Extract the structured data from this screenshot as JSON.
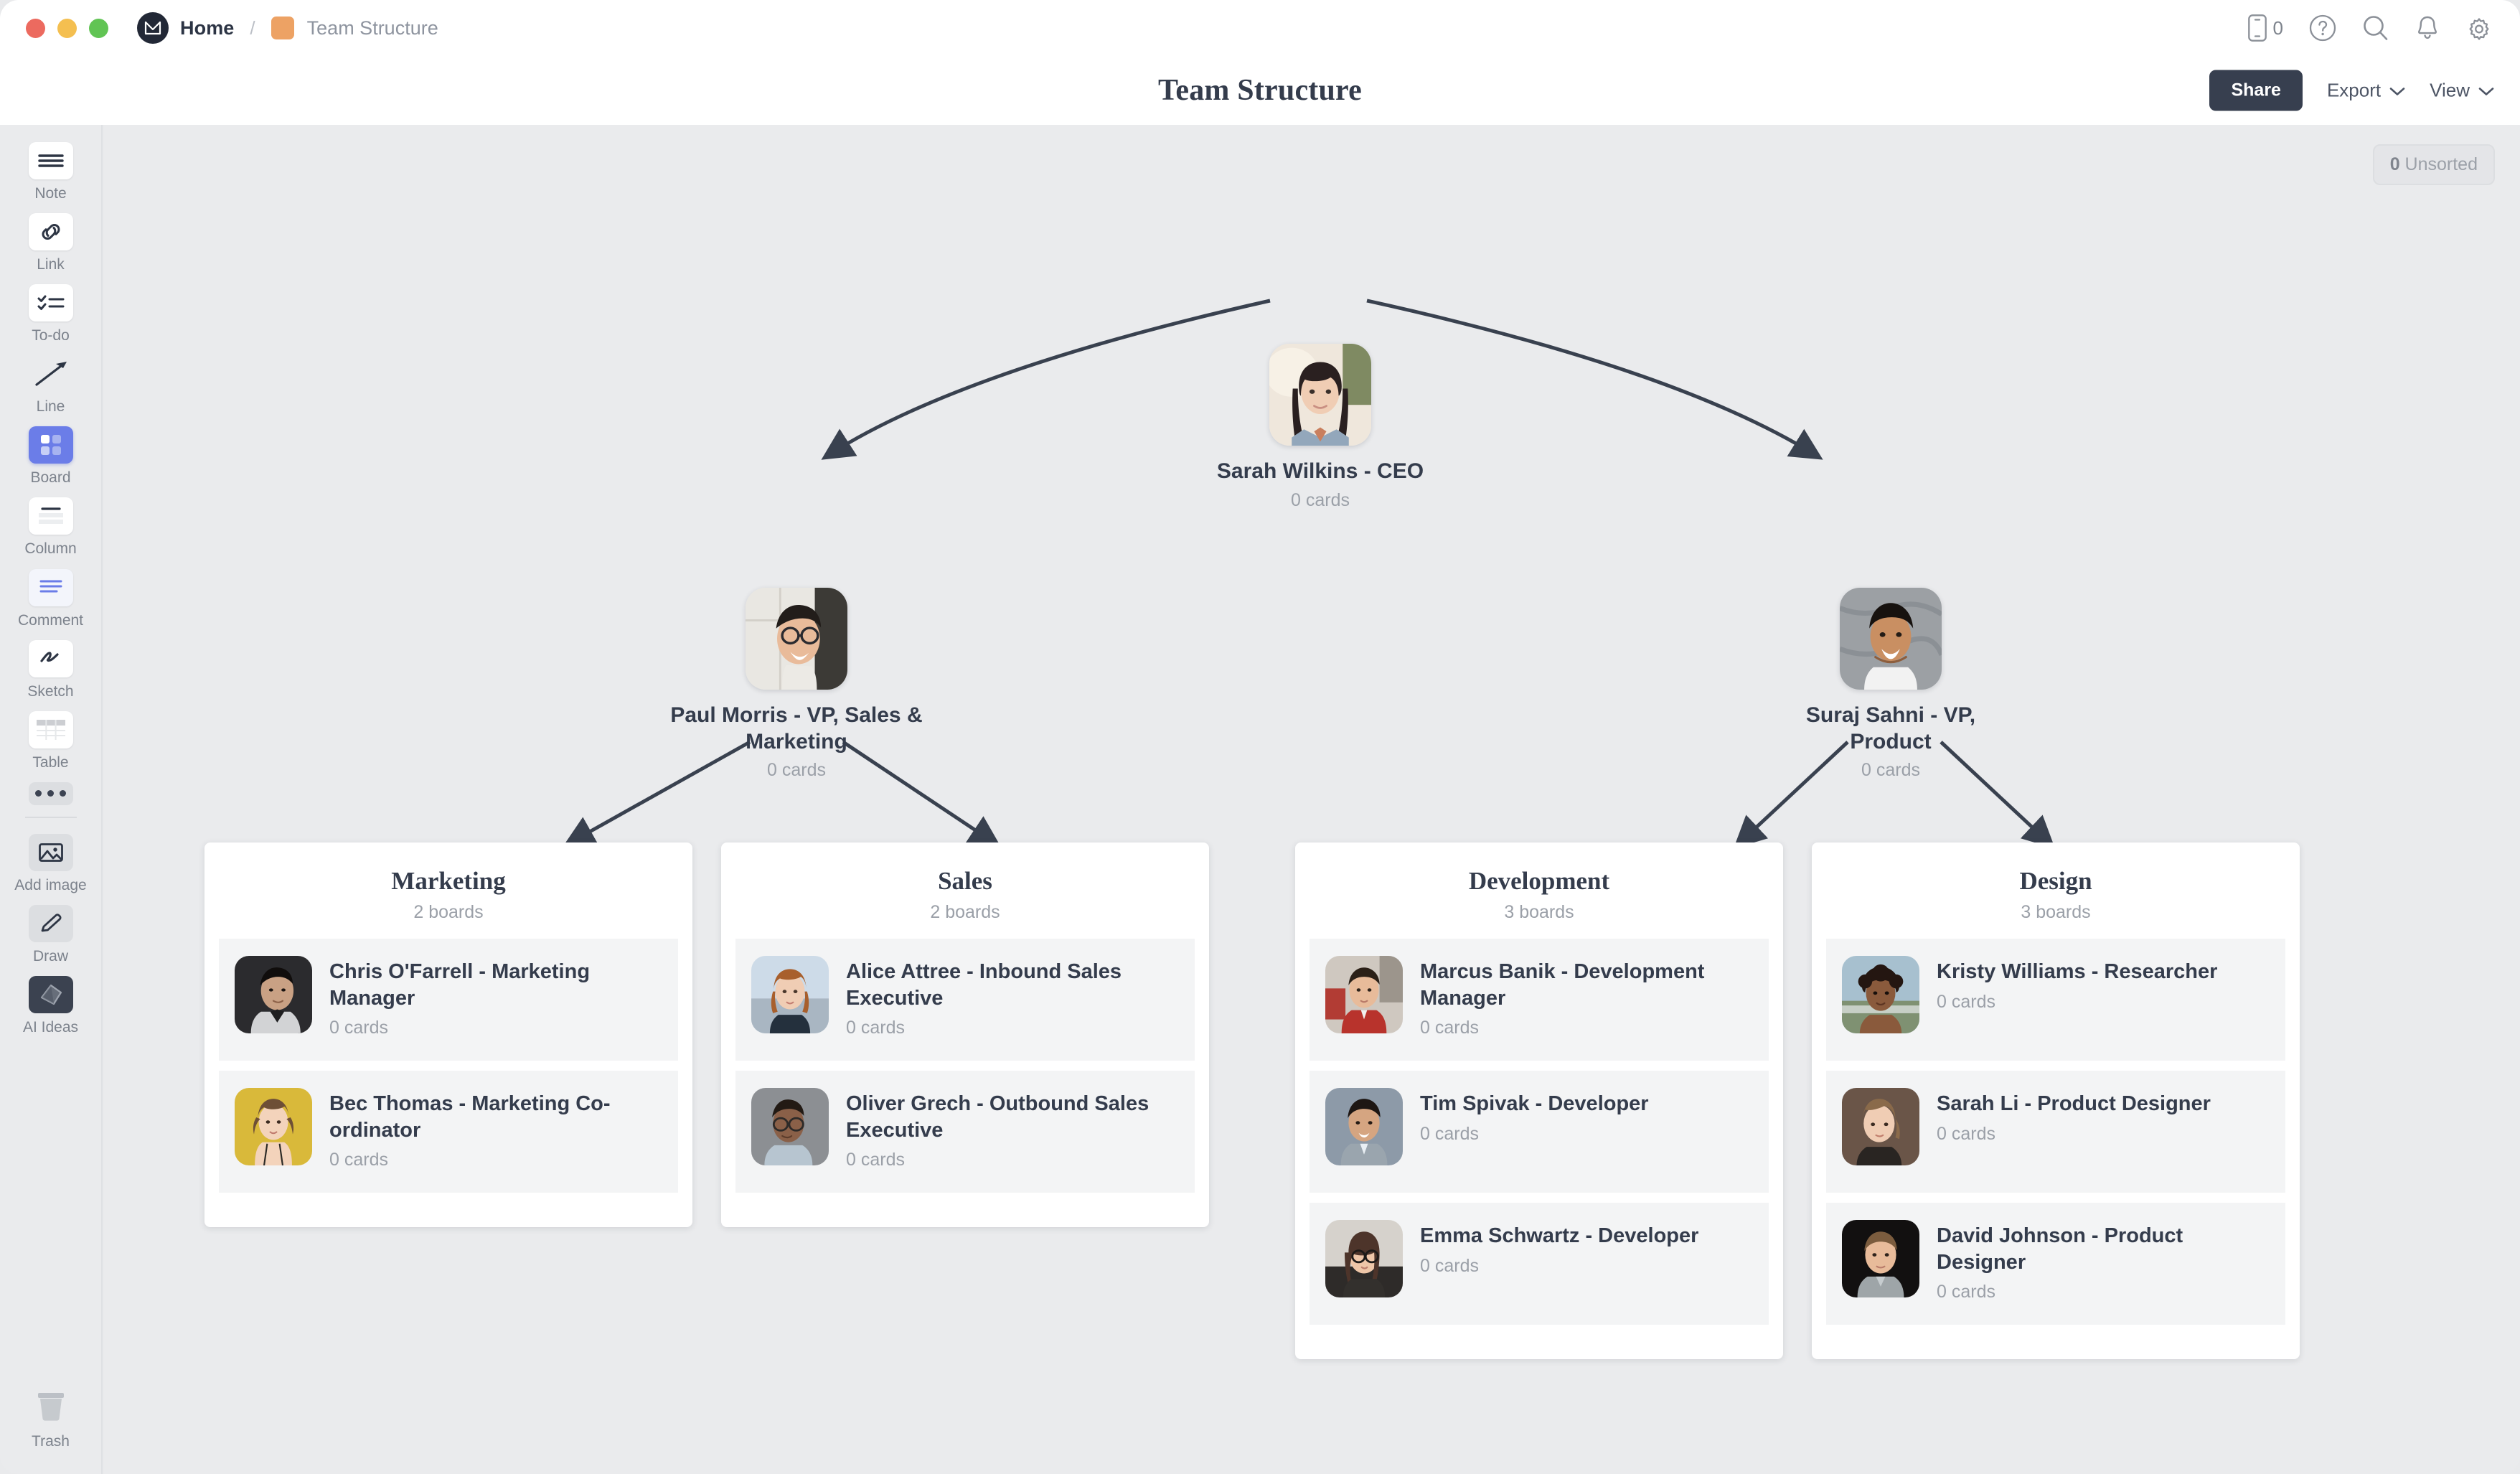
{
  "titlebar": {
    "breadcrumb_home": "Home",
    "breadcrumb_sep": "/",
    "breadcrumb_doc": "Team Structure",
    "card_count": "0",
    "icons": [
      "mobile-card-icon",
      "help-icon",
      "search-icon",
      "bell-icon",
      "gear-icon"
    ]
  },
  "header": {
    "title": "Team Structure",
    "share_label": "Share",
    "export_label": "Export",
    "view_label": "View"
  },
  "canvas": {
    "unsorted_count": "0",
    "unsorted_label": "Unsorted"
  },
  "sidebar": {
    "items": [
      {
        "label": "Note",
        "icon": "note-icon"
      },
      {
        "label": "Link",
        "icon": "link-icon"
      },
      {
        "label": "To-do",
        "icon": "todo-icon"
      },
      {
        "label": "Line",
        "icon": "line-icon"
      },
      {
        "label": "Board",
        "icon": "board-icon"
      },
      {
        "label": "Column",
        "icon": "column-icon"
      },
      {
        "label": "Comment",
        "icon": "comment-icon"
      },
      {
        "label": "Sketch",
        "icon": "sketch-icon"
      },
      {
        "label": "Table",
        "icon": "table-icon"
      },
      {
        "label": "Add image",
        "icon": "image-icon"
      },
      {
        "label": "Draw",
        "icon": "pencil-icon"
      },
      {
        "label": "AI Ideas",
        "icon": "ai-ideas-icon"
      },
      {
        "label": "Trash",
        "icon": "trash-icon"
      }
    ],
    "more_label": "more-options-icon"
  },
  "org": {
    "ceo": {
      "name": "Sarah Wilkins - CEO",
      "cards": "0 cards"
    },
    "vps": [
      {
        "name": "Paul Morris - VP, Sales & Marketing",
        "cards": "0 cards"
      },
      {
        "name": "Suraj Sahni - VP, Product",
        "cards": "0 cards"
      }
    ],
    "boards": [
      {
        "title": "Marketing",
        "subtitle": "2 boards",
        "cards": [
          {
            "name": "Chris O'Farrell - Marketing Manager",
            "cards": "0 cards"
          },
          {
            "name": "Bec Thomas - Marketing Co-ordinator",
            "cards": "0 cards"
          }
        ]
      },
      {
        "title": "Sales",
        "subtitle": "2 boards",
        "cards": [
          {
            "name": "Alice Attree - Inbound Sales Executive",
            "cards": "0 cards"
          },
          {
            "name": "Oliver Grech - Outbound Sales Executive",
            "cards": "0 cards"
          }
        ]
      },
      {
        "title": "Development",
        "subtitle": "3 boards",
        "cards": [
          {
            "name": "Marcus Banik - Development Manager",
            "cards": "0 cards"
          },
          {
            "name": "Tim Spivak - Developer",
            "cards": "0 cards"
          },
          {
            "name": "Emma Schwartz - Developer",
            "cards": "0 cards"
          }
        ]
      },
      {
        "title": "Design",
        "subtitle": "3 boards",
        "cards": [
          {
            "name": "Kristy Williams - Researcher",
            "cards": "0 cards"
          },
          {
            "name": "Sarah Li - Product Designer",
            "cards": "0 cards"
          },
          {
            "name": "David Johnson - Product Designer",
            "cards": "0 cards"
          }
        ]
      }
    ]
  },
  "colors": {
    "accent_board": "#6b7de8",
    "share_button": "#373f4f",
    "canvas_bg": "#eaebed",
    "text_dark": "#343c4c",
    "text_muted": "#9ba0a8",
    "breadcrumb_swatch": "#eda264"
  }
}
